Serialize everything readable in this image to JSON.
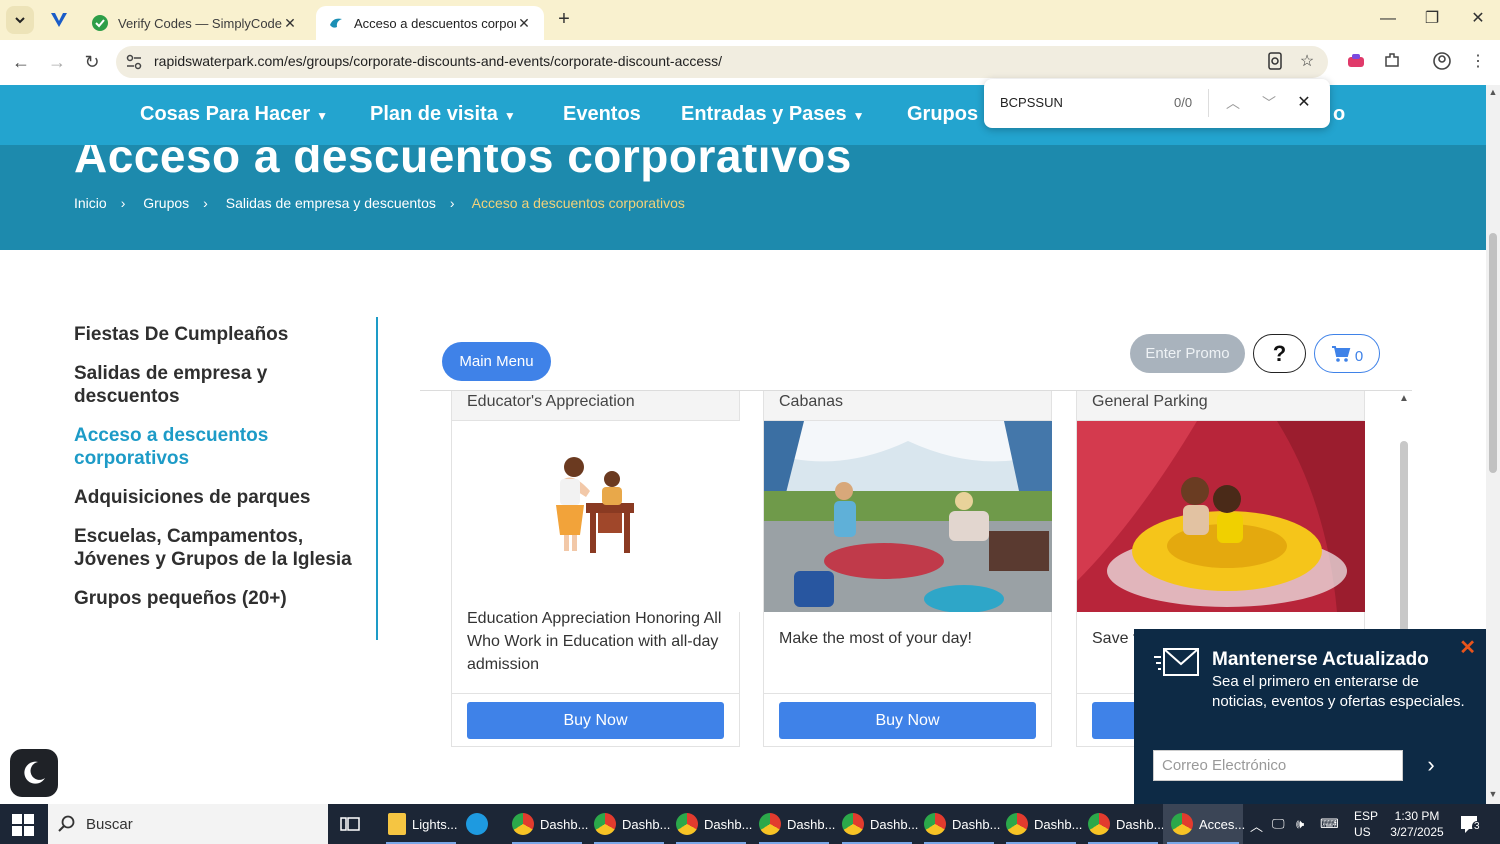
{
  "browser": {
    "tabs": [
      {
        "title": "Verify Codes — SimplyCodes",
        "active": false
      },
      {
        "title": "Acceso a descuentos corporativ",
        "active": true
      }
    ],
    "url": "rapidswaterpark.com/es/groups/corporate-discounts-and-events/corporate-discount-access/"
  },
  "findbar": {
    "query": "BCPSSUN",
    "count": "0/0"
  },
  "nav": {
    "items": [
      {
        "label": "Cosas Para Hacer",
        "has_dropdown": true
      },
      {
        "label": "Plan de visita",
        "has_dropdown": true
      },
      {
        "label": "Eventos",
        "has_dropdown": false
      },
      {
        "label": "Entradas y Pases",
        "has_dropdown": true
      },
      {
        "label": "Grupos",
        "has_dropdown": false
      },
      {
        "label": "o",
        "has_dropdown": false
      }
    ]
  },
  "hero": {
    "title": "Acceso a descuentos corporativos",
    "breadcrumbs": [
      "Inicio",
      "Grupos",
      "Salidas de empresa y descuentos",
      "Acceso a descuentos corporativos"
    ],
    "separator": "›"
  },
  "sidebar": {
    "items": [
      {
        "label": "Fiestas De Cumpleaños",
        "active": false
      },
      {
        "label": "Salidas de empresa y descuentos",
        "active": false
      },
      {
        "label": "Acceso a descuentos corporativos",
        "active": true
      },
      {
        "label": "Adquisiciones de parques",
        "active": false
      },
      {
        "label": "Escuelas, Campamentos, Jóvenes y Grupos de la Iglesia",
        "active": false
      },
      {
        "label": "Grupos pequeños (20+)",
        "active": false
      }
    ]
  },
  "widget": {
    "main_menu": "Main Menu",
    "enter_promo": "Enter Promo",
    "help": "?",
    "cart_count": "0",
    "cards": [
      {
        "title": "Educator's Appreciation",
        "description": "Education Appreciation Honoring All Who Work in Education with all-day admission",
        "button": "Buy Now"
      },
      {
        "title": "Cabanas",
        "description": "Make the most of your day!",
        "button": "Buy Now"
      },
      {
        "title": "General Parking",
        "description": "Save t",
        "button": "Buy Now"
      }
    ]
  },
  "newsletter": {
    "title": "Mantenerse Actualizado",
    "text": "Sea el primero en enterarse de noticias, eventos y ofertas especiales.",
    "placeholder": "Correo Electrónico"
  },
  "taskbar": {
    "search": "Buscar",
    "items": [
      {
        "label": "Lights..."
      },
      {
        "label": ""
      },
      {
        "label": "Dashb..."
      },
      {
        "label": "Dashb..."
      },
      {
        "label": "Dashb..."
      },
      {
        "label": "Dashb..."
      },
      {
        "label": "Dashb..."
      },
      {
        "label": "Dashb..."
      },
      {
        "label": "Dashb..."
      },
      {
        "label": "Dashb..."
      },
      {
        "label": "Acces..."
      }
    ],
    "lang": "ESP",
    "region": "US",
    "time": "1:30 PM",
    "date": "3/27/2025",
    "notifications": "3"
  },
  "colors": {
    "brand_blue": "#23a4cf",
    "hero_blue": "#1d8aad",
    "button_blue": "#3f82e8",
    "newsletter_bg": "#0d2a45",
    "tab_strip": "#f9f1cf"
  }
}
